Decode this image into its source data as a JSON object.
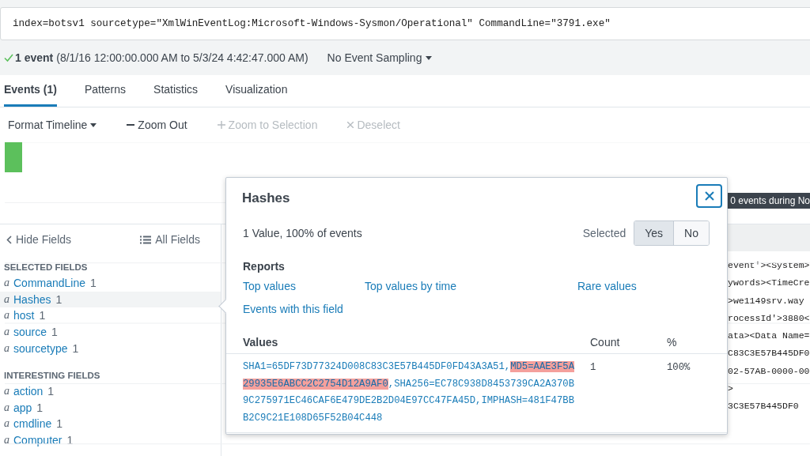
{
  "search": {
    "query": "index=botsv1 sourcetype=\"XmlWinEventLog:Microsoft-Windows-Sysmon/Operational\" CommandLine=\"3791.exe\""
  },
  "status": {
    "count": "1 event",
    "range": "(8/1/16 12:00:00.000 AM to 5/3/24 4:42:47.000 AM)",
    "sampling": "No Event Sampling"
  },
  "tabs": [
    {
      "label": "Events (1)",
      "selected": true
    },
    {
      "label": "Patterns",
      "selected": false
    },
    {
      "label": "Statistics",
      "selected": false
    },
    {
      "label": "Visualization",
      "selected": false
    }
  ],
  "timeline_toolbar": [
    {
      "label": "Format Timeline",
      "kind": "caret",
      "disabled": false
    },
    {
      "label": "Zoom Out",
      "kind": "minus",
      "disabled": false
    },
    {
      "label": "Zoom to Selection",
      "kind": "plus",
      "disabled": true
    },
    {
      "label": "Deselect",
      "kind": "cross",
      "disabled": true
    }
  ],
  "timeline": {
    "tooltip": "0 events during No"
  },
  "sidebar": {
    "hide_fields": "Hide Fields",
    "all_fields": "All Fields",
    "groups": [
      {
        "title": "SELECTED FIELDS",
        "fields": [
          {
            "type": "a",
            "name": "CommandLine",
            "count": "1",
            "selected": false
          },
          {
            "type": "a",
            "name": "Hashes",
            "count": "1",
            "selected": true
          },
          {
            "type": "a",
            "name": "host",
            "count": "1",
            "selected": false
          },
          {
            "type": "a",
            "name": "source",
            "count": "1",
            "selected": false
          },
          {
            "type": "a",
            "name": "sourcetype",
            "count": "1",
            "selected": false
          }
        ]
      },
      {
        "title": "INTERESTING FIELDS",
        "fields": [
          {
            "type": "a",
            "name": "action",
            "count": "1",
            "selected": false
          },
          {
            "type": "a",
            "name": "app",
            "count": "1",
            "selected": false
          },
          {
            "type": "a",
            "name": "cmdline",
            "count": "1",
            "selected": false
          },
          {
            "type": "a",
            "name": "Computer",
            "count": "1",
            "selected": false
          }
        ]
      }
    ]
  },
  "events": {
    "lines": [
      "event'><System>",
      "ywords><TimeCre",
      ">we1149srv.way",
      "rocessId'>3880<",
      "ata><Data Name=",
      "C83C3E57B445DF0",
      "02-57AB-0000-00",
      ">",
      "3C3E57B445DF0"
    ]
  },
  "popover": {
    "title": "Hashes",
    "summary": "1 Value, 100% of events",
    "selected_label": "Selected",
    "selected_options": [
      {
        "label": "Yes",
        "selected": true
      },
      {
        "label": "No",
        "selected": false
      }
    ],
    "reports_title": "Reports",
    "reports": [
      "Top values",
      "Top values by time",
      "Rare values",
      "Events with this field"
    ],
    "values_columns": [
      "Values",
      "Count",
      "%"
    ],
    "values": [
      {
        "parts": [
          {
            "text": "SHA1=65DF73D77324D008C83C3E57B445DF0FD43A3A51,",
            "highlighted": false
          },
          {
            "text": "MD5=AAE3F5A29935E6ABCC2C2754D12A9AF0",
            "highlighted": true
          },
          {
            "text": ",SHA256=EC78C938D8453739CA2A370B9C275971EC46CAF6E479DE2B2D04E97CC47FA45D,IMPHASH=481F47BBB2C9C21E108D65F52B04C448",
            "highlighted": false
          }
        ],
        "count": "1",
        "percent": "100%"
      }
    ]
  }
}
